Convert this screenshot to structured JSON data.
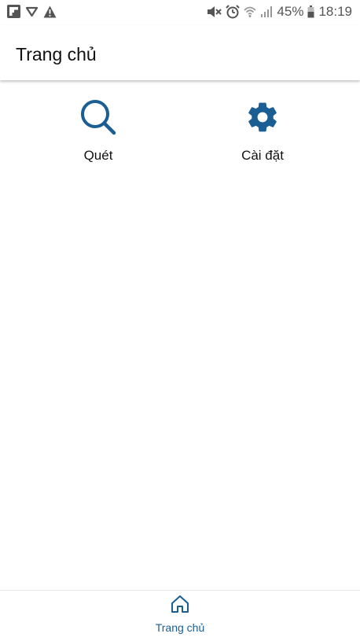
{
  "status_bar": {
    "left_icons": [
      "flipboard-icon",
      "download-icon",
      "warning-icon"
    ],
    "right_icons": [
      "mute-icon",
      "alarm-icon",
      "wifi-icon",
      "signal-icon"
    ],
    "battery": "45%",
    "time": "18:19"
  },
  "app_bar": {
    "title": "Trang chủ"
  },
  "tiles": [
    {
      "label": "Quét",
      "icon": "search-icon"
    },
    {
      "label": "Cài đặt",
      "icon": "gear-icon"
    }
  ],
  "bottom_nav": {
    "items": [
      {
        "label": "Trang chủ",
        "icon": "home-icon",
        "active": true
      }
    ]
  },
  "colors": {
    "accent": "#1a5e93",
    "text": "#111111"
  }
}
